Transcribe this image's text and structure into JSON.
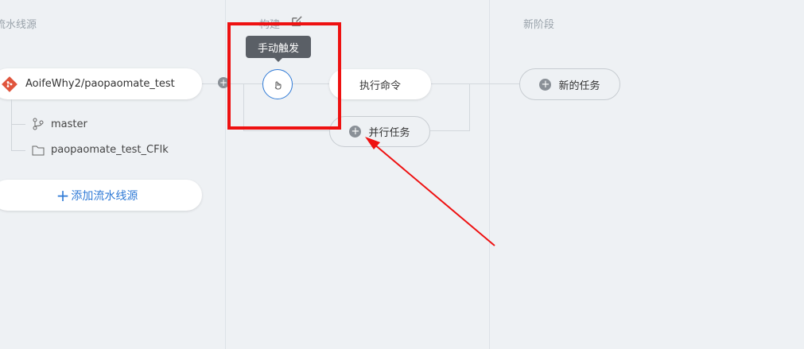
{
  "columns": {
    "source": {
      "title": "流水线源"
    },
    "build": {
      "title": "构建"
    },
    "new_stage": {
      "title": "新阶段"
    }
  },
  "source": {
    "repo": "AoifeWhy2/paopaomate_test",
    "branch": "master",
    "folder": "paopaomate_test_CFlk",
    "add_source_plus": "+",
    "add_source_label": "添加流水线源"
  },
  "build": {
    "trigger_tooltip": "手动触发",
    "task_label": "执行命令",
    "parallel_task_label": "并行任务",
    "connector_plus": "+"
  },
  "new_stage": {
    "new_task_label": "新的任务"
  },
  "colors": {
    "accent": "#2f7ad6",
    "annotation": "#ee1111"
  }
}
